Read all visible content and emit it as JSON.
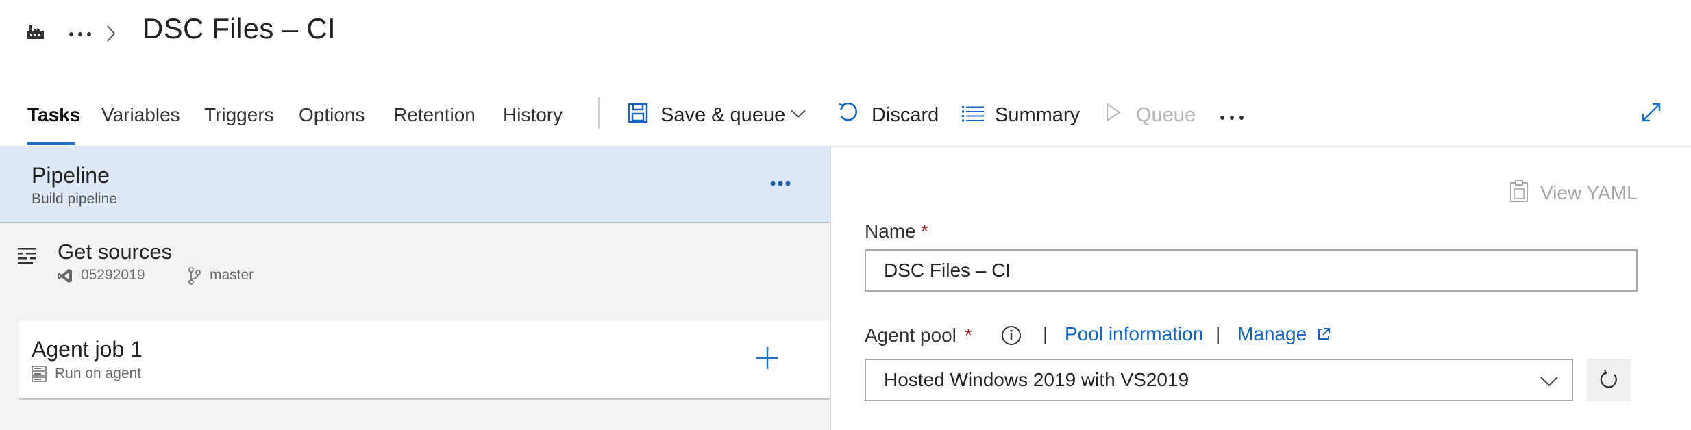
{
  "header": {
    "title": "DSC Files – CI",
    "build_icon": "build-factory-icon",
    "more_icon": "ellipsis-icon",
    "separator_icon": "chevron-right-icon"
  },
  "tabs": [
    {
      "label": "Tasks",
      "active": true
    },
    {
      "label": "Variables",
      "active": false
    },
    {
      "label": "Triggers",
      "active": false
    },
    {
      "label": "Options",
      "active": false
    },
    {
      "label": "Retention",
      "active": false
    },
    {
      "label": "History",
      "active": false
    }
  ],
  "toolbar": {
    "save_queue_label": "Save & queue",
    "discard_label": "Discard",
    "summary_label": "Summary",
    "queue_label": "Queue",
    "queue_disabled": true,
    "icons": [
      "save-icon",
      "chevron-down-icon",
      "undo-icon",
      "list-icon",
      "play-icon",
      "more-icon",
      "expand-icon"
    ]
  },
  "pipeline": {
    "title": "Pipeline",
    "subtitle": "Build pipeline"
  },
  "get_sources": {
    "title": "Get sources",
    "repo": "05292019",
    "branch": "master"
  },
  "agent_job": {
    "title": "Agent job 1",
    "subtitle": "Run on agent"
  },
  "details": {
    "view_yaml_label": "View YAML",
    "name_label": "Name",
    "required_mark": "*",
    "name_value": "DSC Files – CI",
    "agent_pool_label": "Agent pool",
    "separator": "|",
    "pool_info_link": "Pool information",
    "manage_link": "Manage",
    "agent_pool_value": "Hosted Windows 2019 with VS2019"
  },
  "colors": {
    "accent": "#1a73c8",
    "link": "#1565c0",
    "selected_card": "#dde9f6",
    "required": "#a4262c"
  }
}
